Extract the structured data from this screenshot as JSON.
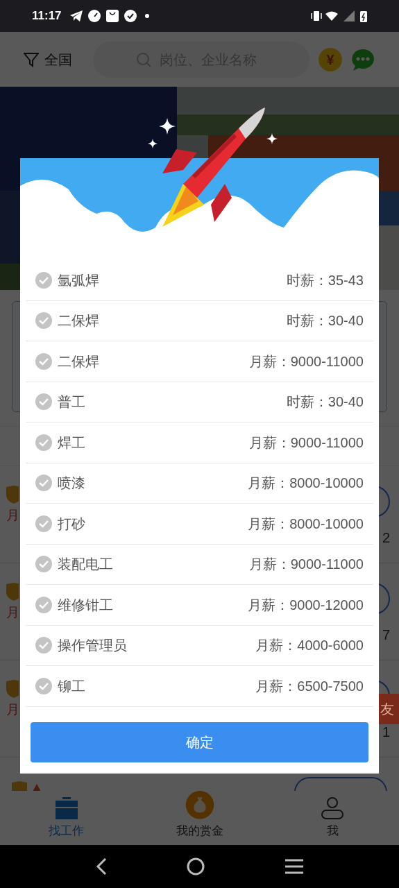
{
  "status_bar": {
    "time": "11:17"
  },
  "header": {
    "location": "全国",
    "search": {
      "placeholder": "岗位、企业名称"
    }
  },
  "job_cards": [
    {
      "salary_fragment": "月",
      "number_fragment": "2"
    },
    {
      "salary_fragment": "月",
      "number_fragment": "7"
    },
    {
      "salary_fragment": "月",
      "number_fragment": "1"
    }
  ],
  "share_badge": "友",
  "coin_symbol": "¥",
  "modal": {
    "jobs": [
      {
        "title": "氩弧焊",
        "pay": "时薪：35-43"
      },
      {
        "title": "二保焊",
        "pay": "时薪：30-40"
      },
      {
        "title": "二保焊",
        "pay": "月薪：9000-11000"
      },
      {
        "title": "普工",
        "pay": "时薪：30-40"
      },
      {
        "title": "焊工",
        "pay": "月薪：9000-11000"
      },
      {
        "title": "喷漆",
        "pay": "月薪：8000-10000"
      },
      {
        "title": "打砂",
        "pay": "月薪：8000-10000"
      },
      {
        "title": "装配电工",
        "pay": "月薪：9000-11000"
      },
      {
        "title": "维修钳工",
        "pay": "月薪：9000-12000"
      },
      {
        "title": "操作管理员",
        "pay": "月薪：4000-6000"
      },
      {
        "title": "铆工",
        "pay": "月薪：6500-7500"
      }
    ],
    "confirm": "确定"
  },
  "bottom_nav": [
    {
      "label": "找工作",
      "selected": true
    },
    {
      "label": "我的赏金",
      "selected": false
    },
    {
      "label": "我",
      "selected": false
    }
  ]
}
